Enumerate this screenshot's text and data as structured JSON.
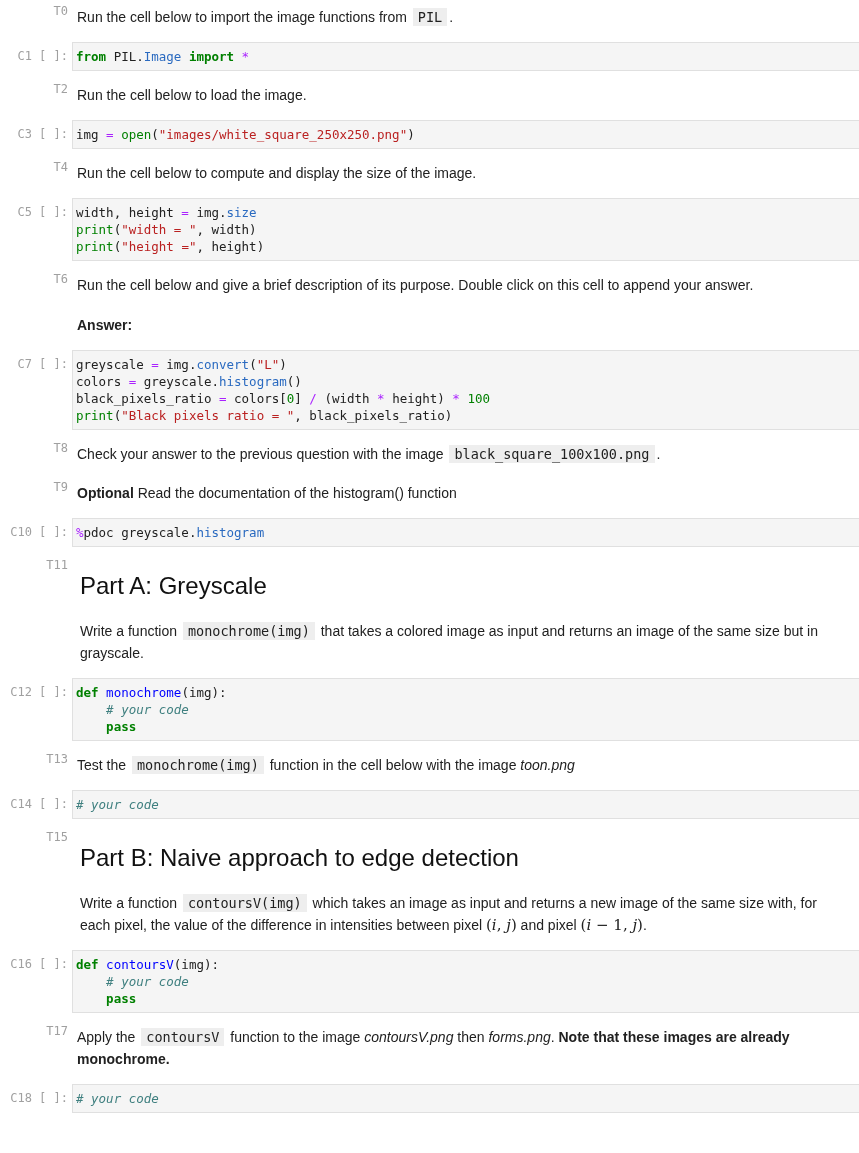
{
  "notebook": {
    "cells": [
      {
        "kind": "markdown",
        "prompt": "T0",
        "blocks": [
          {
            "kind": "paragraph",
            "runs": [
              {
                "kind": "text",
                "t": "Run the cell below to import the image functions from "
              },
              {
                "kind": "code",
                "t": "PIL"
              },
              {
                "kind": "text",
                "t": "."
              }
            ]
          }
        ]
      },
      {
        "kind": "code",
        "prompt": "C1 [ ]:",
        "lines": [
          [
            {
              "kind": "keyword",
              "t": "from"
            },
            {
              "kind": "plain",
              "t": " PIL."
            },
            {
              "kind": "attr",
              "t": "Image "
            },
            {
              "kind": "keyword",
              "t": "import "
            },
            {
              "kind": "op",
              "t": "*"
            }
          ]
        ]
      },
      {
        "kind": "markdown",
        "prompt": "T2",
        "blocks": [
          {
            "kind": "paragraph",
            "runs": [
              {
                "kind": "text",
                "t": "Run the cell below to load the image."
              }
            ]
          }
        ]
      },
      {
        "kind": "code",
        "prompt": "C3 [ ]:",
        "lines": [
          [
            {
              "kind": "plain",
              "t": "img "
            },
            {
              "kind": "op",
              "t": "= "
            },
            {
              "kind": "builtin",
              "t": "open"
            },
            {
              "kind": "plain",
              "t": "("
            },
            {
              "kind": "string",
              "t": "\"images/white_square_250x250.png\""
            },
            {
              "kind": "plain",
              "t": ")"
            }
          ]
        ]
      },
      {
        "kind": "markdown",
        "prompt": "T4",
        "blocks": [
          {
            "kind": "paragraph",
            "runs": [
              {
                "kind": "text",
                "t": "Run the cell below to compute and display the size of the image."
              }
            ]
          }
        ]
      },
      {
        "kind": "code",
        "prompt": "C5 [ ]:",
        "lines": [
          [
            {
              "kind": "plain",
              "t": "width, height "
            },
            {
              "kind": "op",
              "t": "="
            },
            {
              "kind": "plain",
              "t": " img."
            },
            {
              "kind": "attr",
              "t": "size"
            }
          ],
          [
            {
              "kind": "builtin",
              "t": "print"
            },
            {
              "kind": "plain",
              "t": "("
            },
            {
              "kind": "string",
              "t": "\"width = \""
            },
            {
              "kind": "plain",
              "t": ", width)"
            }
          ],
          [
            {
              "kind": "builtin",
              "t": "print"
            },
            {
              "kind": "plain",
              "t": "("
            },
            {
              "kind": "string",
              "t": "\"height =\""
            },
            {
              "kind": "plain",
              "t": ", height)"
            }
          ]
        ]
      },
      {
        "kind": "markdown",
        "prompt": "T6",
        "blocks": [
          {
            "kind": "paragraph",
            "runs": [
              {
                "kind": "text",
                "t": "Run the cell below and give a brief description of its purpose. Double click on this cell to append your answer."
              }
            ]
          },
          {
            "kind": "paragraph",
            "runs": [
              {
                "kind": "bold",
                "t": "Answer:"
              }
            ]
          }
        ]
      },
      {
        "kind": "code",
        "prompt": "C7 [ ]:",
        "lines": [
          [
            {
              "kind": "plain",
              "t": "greyscale "
            },
            {
              "kind": "op",
              "t": "="
            },
            {
              "kind": "plain",
              "t": " img."
            },
            {
              "kind": "attr",
              "t": "convert"
            },
            {
              "kind": "plain",
              "t": "("
            },
            {
              "kind": "string",
              "t": "\"L\""
            },
            {
              "kind": "plain",
              "t": ")"
            }
          ],
          [
            {
              "kind": "plain",
              "t": "colors "
            },
            {
              "kind": "op",
              "t": "="
            },
            {
              "kind": "plain",
              "t": " greyscale."
            },
            {
              "kind": "attr",
              "t": "histogram"
            },
            {
              "kind": "plain",
              "t": "()"
            }
          ],
          [
            {
              "kind": "plain",
              "t": "black_pixels_ratio "
            },
            {
              "kind": "op",
              "t": "="
            },
            {
              "kind": "plain",
              "t": " colors["
            },
            {
              "kind": "number",
              "t": "0"
            },
            {
              "kind": "plain",
              "t": "] "
            },
            {
              "kind": "op",
              "t": "/"
            },
            {
              "kind": "plain",
              "t": " (width "
            },
            {
              "kind": "op",
              "t": "*"
            },
            {
              "kind": "plain",
              "t": " height) "
            },
            {
              "kind": "op",
              "t": "* "
            },
            {
              "kind": "number",
              "t": "100"
            }
          ],
          [
            {
              "kind": "builtin",
              "t": "print"
            },
            {
              "kind": "plain",
              "t": "("
            },
            {
              "kind": "string",
              "t": "\"Black pixels ratio = \""
            },
            {
              "kind": "plain",
              "t": ", black_pixels_ratio)"
            }
          ]
        ]
      },
      {
        "kind": "markdown",
        "prompt": "T8",
        "blocks": [
          {
            "kind": "paragraph",
            "runs": [
              {
                "kind": "text",
                "t": "Check your answer to the previous question with the image "
              },
              {
                "kind": "code",
                "t": "black_square_100x100.png"
              },
              {
                "kind": "text",
                "t": "."
              }
            ]
          }
        ]
      },
      {
        "kind": "markdown",
        "prompt": "T9",
        "blocks": [
          {
            "kind": "paragraph",
            "runs": [
              {
                "kind": "bold",
                "t": "Optional"
              },
              {
                "kind": "text",
                "t": " Read the documentation of the histogram() function"
              }
            ]
          }
        ]
      },
      {
        "kind": "code",
        "prompt": "C10 [ ]:",
        "lines": [
          [
            {
              "kind": "op",
              "t": "%"
            },
            {
              "kind": "plain",
              "t": "pdoc greyscale."
            },
            {
              "kind": "attr",
              "t": "histogram"
            }
          ]
        ]
      },
      {
        "kind": "markdown",
        "prompt": "T11",
        "blocks": [
          {
            "kind": "heading",
            "runs": [
              {
                "kind": "text",
                "t": "Part A: Greyscale"
              }
            ]
          },
          {
            "kind": "paragraph",
            "runs": [
              {
                "kind": "text",
                "t": "Write a function "
              },
              {
                "kind": "code",
                "t": "monochrome(img)"
              },
              {
                "kind": "text",
                "t": " that takes a colored image as input and returns an image of the same size but in grayscale."
              }
            ]
          }
        ]
      },
      {
        "kind": "code",
        "prompt": "C12 [ ]:",
        "lines": [
          [
            {
              "kind": "keyword",
              "t": "def "
            },
            {
              "kind": "defname",
              "t": "monochrome"
            },
            {
              "kind": "plain",
              "t": "(img):"
            }
          ],
          [
            {
              "kind": "comment",
              "t": "    # your code"
            }
          ],
          [
            {
              "kind": "keyword",
              "t": "    pass"
            }
          ]
        ]
      },
      {
        "kind": "markdown",
        "prompt": "T13",
        "blocks": [
          {
            "kind": "paragraph",
            "runs": [
              {
                "kind": "text",
                "t": "Test the "
              },
              {
                "kind": "code",
                "t": "monochrome(img)"
              },
              {
                "kind": "text",
                "t": " function in the cell below with the image "
              },
              {
                "kind": "italic",
                "t": "toon.png"
              }
            ]
          }
        ]
      },
      {
        "kind": "code",
        "prompt": "C14 [ ]:",
        "lines": [
          [
            {
              "kind": "comment",
              "t": "# your code"
            }
          ]
        ]
      },
      {
        "kind": "markdown",
        "prompt": "T15",
        "blocks": [
          {
            "kind": "heading",
            "runs": [
              {
                "kind": "text",
                "t": "Part B: Naive approach to edge detection"
              }
            ]
          },
          {
            "kind": "paragraph",
            "runs": [
              {
                "kind": "text",
                "t": "Write a function "
              },
              {
                "kind": "code",
                "t": "contoursV(img)"
              },
              {
                "kind": "text",
                "t": " which takes an image as input and returns a new image of the same size with, for each pixel, the value of the difference in intensities between pixel "
              },
              {
                "kind": "math",
                "t": "(*i*, *j*)"
              },
              {
                "kind": "text",
                "t": " and pixel "
              },
              {
                "kind": "math",
                "t": "(*i* − 1, *j*)"
              },
              {
                "kind": "text",
                "t": "."
              }
            ]
          }
        ]
      },
      {
        "kind": "code",
        "prompt": "C16 [ ]:",
        "lines": [
          [
            {
              "kind": "keyword",
              "t": "def "
            },
            {
              "kind": "defname",
              "t": "contoursV"
            },
            {
              "kind": "plain",
              "t": "(img):"
            }
          ],
          [
            {
              "kind": "comment",
              "t": "    # your code"
            }
          ],
          [
            {
              "kind": "keyword",
              "t": "    pass"
            }
          ]
        ]
      },
      {
        "kind": "markdown",
        "prompt": "T17",
        "blocks": [
          {
            "kind": "paragraph",
            "runs": [
              {
                "kind": "text",
                "t": "Apply the "
              },
              {
                "kind": "code",
                "t": "contoursV"
              },
              {
                "kind": "text",
                "t": " function to the image "
              },
              {
                "kind": "italic",
                "t": "contoursV.png"
              },
              {
                "kind": "text",
                "t": " then "
              },
              {
                "kind": "italic",
                "t": "forms.png"
              },
              {
                "kind": "text",
                "t": ". "
              },
              {
                "kind": "bold",
                "t": "Note that these images are already monochrome."
              }
            ]
          }
        ]
      },
      {
        "kind": "code",
        "prompt": "C18 [ ]:",
        "lines": [
          [
            {
              "kind": "comment",
              "t": "# your code"
            }
          ]
        ]
      }
    ]
  }
}
